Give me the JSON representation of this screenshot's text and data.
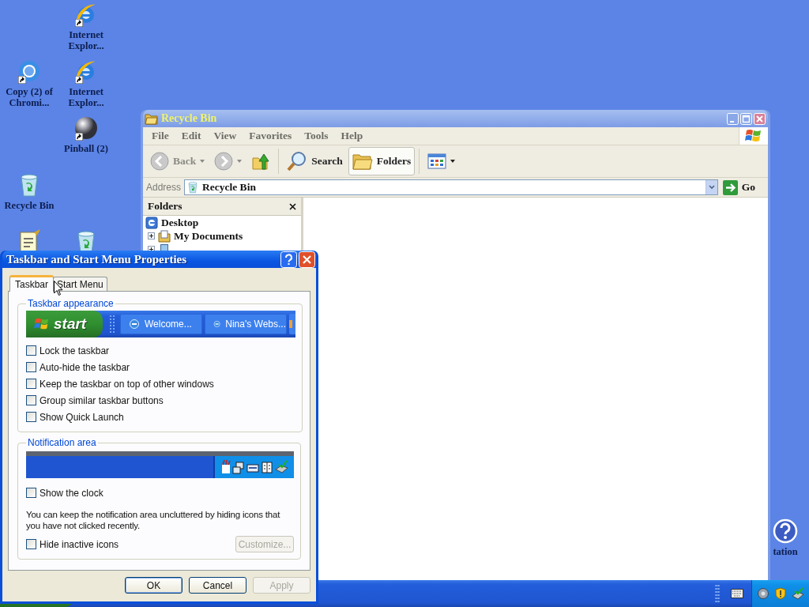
{
  "desktop_icons": [
    {
      "kind": "ie",
      "label": "Internet Explor...",
      "shortcut": true
    },
    {
      "kind": "chrome",
      "label": "Copy (2) of Chromi...",
      "shortcut": true
    },
    {
      "kind": "ie",
      "label": "Internet Explor...",
      "shortcut": true
    },
    {
      "kind": "pinball",
      "label": "Pinball (2)",
      "shortcut": true
    },
    {
      "kind": "recycle",
      "label": "Recycle Bin",
      "shortcut": false
    },
    {
      "kind": "notepad",
      "shortcut": false
    },
    {
      "kind": "recycle",
      "shortcut": false
    },
    {
      "kind": "help",
      "label": "tation",
      "shortcut": false
    }
  ],
  "explorer": {
    "title": "Recycle Bin",
    "menu": [
      "File",
      "Edit",
      "View",
      "Favorites",
      "Tools",
      "Help"
    ],
    "toolbar": [
      {
        "kind": "back",
        "label": "Back",
        "pressed": false
      },
      {
        "kind": "forward",
        "pressed": false
      },
      {
        "kind": "up",
        "pressed": false
      },
      {
        "kind": "search",
        "label": "Search",
        "pressed": false
      },
      {
        "kind": "folders",
        "label": "Folders",
        "pressed": true
      },
      {
        "kind": "views",
        "pressed": false
      }
    ],
    "address": {
      "label": "Address",
      "value": "Recycle Bin",
      "go": "Go"
    },
    "folders_pane": {
      "title": "Folders",
      "tree": [
        {
          "label": "Desktop",
          "children": [
            {
              "label": "My Documents",
              "expanded": false
            },
            {
              "expanded": false
            }
          ]
        }
      ]
    }
  },
  "dialog": {
    "title": "Taskbar and Start Menu Properties",
    "tabs": [
      {
        "label": "Taskbar",
        "selected": true
      },
      {
        "label": "Start Menu",
        "selected": false
      }
    ],
    "taskbar_appearance": {
      "heading": "Taskbar appearance",
      "preview": {
        "start": "start",
        "buttons": [
          "Welcome...",
          "Nina's Webs..."
        ]
      },
      "options": [
        {
          "label": "Lock the taskbar",
          "checked": false
        },
        {
          "label": "Auto-hide the taskbar",
          "checked": false
        },
        {
          "label": "Keep the taskbar on top of other windows",
          "checked": false
        },
        {
          "label": "Group similar taskbar buttons",
          "checked": false
        },
        {
          "label": "Show Quick Launch",
          "checked": false
        }
      ]
    },
    "notification_area": {
      "heading": "Notification area",
      "clock_option": {
        "label": "Show the clock",
        "checked": false
      },
      "note": "You can keep the notification area uncluttered by hiding icons that you have not clicked recently.",
      "hide_option": {
        "label": "Hide inactive icons",
        "checked": false
      },
      "customize_button": {
        "label": "Customize...",
        "disabled": true
      }
    },
    "buttons": [
      {
        "label": "OK",
        "disabled": false,
        "default": true
      },
      {
        "label": "Cancel",
        "disabled": false,
        "default": false
      },
      {
        "label": "Apply",
        "disabled": true,
        "default": false
      }
    ]
  }
}
